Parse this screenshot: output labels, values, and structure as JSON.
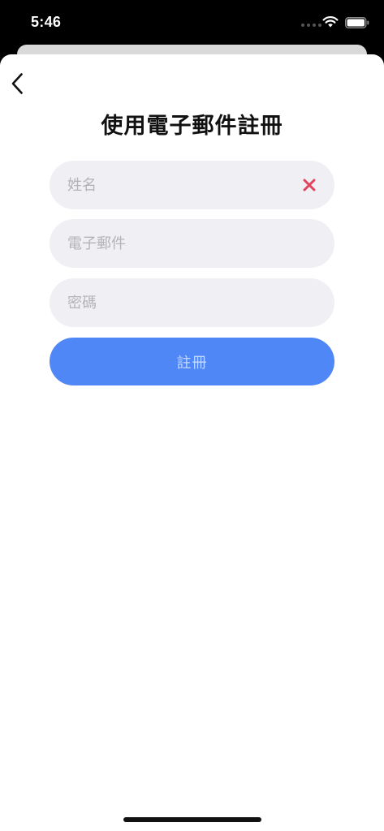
{
  "status_bar": {
    "time": "5:46",
    "wifi_icon": "wifi-icon",
    "battery_icon": "battery-icon"
  },
  "nav": {
    "back_icon": "chevron-left-icon"
  },
  "page": {
    "title": "使用電子郵件註冊"
  },
  "form": {
    "name": {
      "placeholder": "姓名",
      "value": "",
      "clear_icon": "close-icon",
      "clear_color": "#e0445f"
    },
    "email": {
      "placeholder": "電子郵件",
      "value": ""
    },
    "password": {
      "placeholder": "密碼",
      "value": ""
    },
    "submit_label": "註冊"
  },
  "colors": {
    "accent": "#4f87f7",
    "field_background": "#efeff4",
    "placeholder": "#b3b3b8"
  }
}
